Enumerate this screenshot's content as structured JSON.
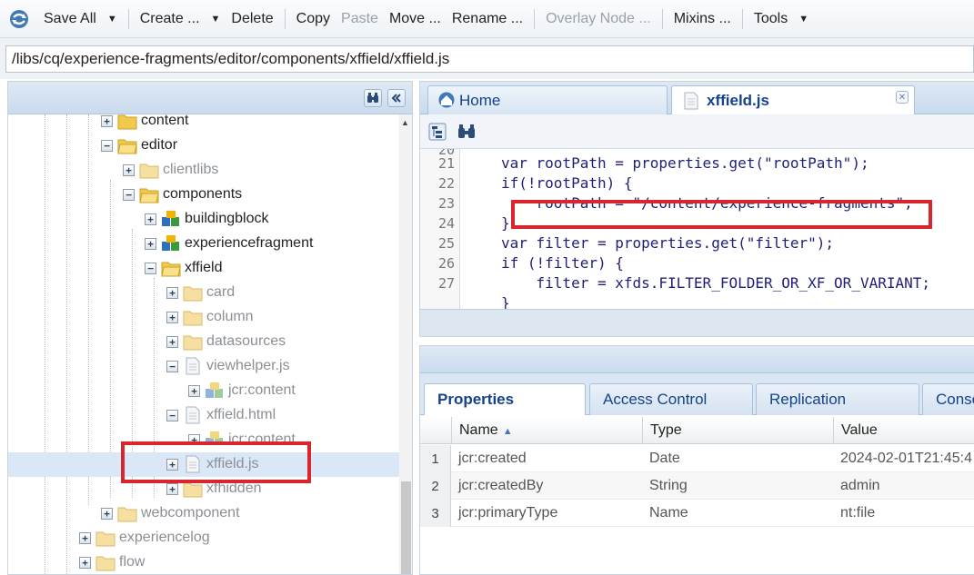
{
  "toolbar": {
    "save_all": "Save All",
    "create": "Create ...",
    "delete": "Delete",
    "copy": "Copy",
    "paste": "Paste",
    "move": "Move ...",
    "rename": "Rename ...",
    "overlay_node": "Overlay Node ...",
    "mixins": "Mixins ...",
    "tools": "Tools"
  },
  "path": {
    "value": "/libs/cq/experience-fragments/editor/components/xffield/xffield.js"
  },
  "tree": {
    "nodes": [
      {
        "label": "content",
        "icon": "folder-icon"
      },
      {
        "label": "editor",
        "icon": "folder-open-icon"
      },
      {
        "label": "clientlibs",
        "icon": "folder-icon"
      },
      {
        "label": "components",
        "icon": "folder-open-icon"
      },
      {
        "label": "buildingblock",
        "icon": "component-icon"
      },
      {
        "label": "experiencefragment",
        "icon": "component-icon"
      },
      {
        "label": "xffield",
        "icon": "folder-open-icon"
      },
      {
        "label": "card",
        "icon": "folder-icon"
      },
      {
        "label": "column",
        "icon": "folder-icon"
      },
      {
        "label": "datasources",
        "icon": "folder-icon"
      },
      {
        "label": "viewhelper.js",
        "icon": "file-icon"
      },
      {
        "label": "jcr:content",
        "icon": "node-icon"
      },
      {
        "label": "xffield.html",
        "icon": "file-icon"
      },
      {
        "label": "jcr:content",
        "icon": "node-icon"
      },
      {
        "label": "xffield.js",
        "icon": "file-icon"
      },
      {
        "label": "xfhidden",
        "icon": "folder-icon"
      },
      {
        "label": "webcomponent",
        "icon": "folder-icon"
      },
      {
        "label": "experiencelog",
        "icon": "folder-icon"
      },
      {
        "label": "flow",
        "icon": "folder-icon"
      }
    ]
  },
  "editor": {
    "tabs": [
      {
        "label": "Home"
      },
      {
        "label": "xffield.js"
      }
    ],
    "lines": [
      {
        "number": "20",
        "text": ""
      },
      {
        "number": "21",
        "text": "var rootPath = properties.get(\"rootPath\");"
      },
      {
        "number": "22",
        "text": "if(!rootPath) {"
      },
      {
        "number": "23",
        "text": "    rootPath = \"/content/experience-fragments\";"
      },
      {
        "number": "24",
        "text": "}"
      },
      {
        "number": "25",
        "text": "var filter = properties.get(\"filter\");"
      },
      {
        "number": "26",
        "text": "if (!filter) {"
      },
      {
        "number": "27",
        "text": "    filter = xfds.FILTER_FOLDER_OR_XF_OR_VARIANT;"
      },
      {
        "number": "",
        "text": "}"
      }
    ]
  },
  "properties": {
    "tabs": [
      "Properties",
      "Access Control",
      "Replication",
      "Conso"
    ],
    "columns": [
      "Name",
      "Type",
      "Value"
    ],
    "rows": [
      {
        "index": "1",
        "name": "jcr:created",
        "type": "Date",
        "value": "2024-02-01T21:45:4"
      },
      {
        "index": "2",
        "name": "jcr:createdBy",
        "type": "String",
        "value": "admin"
      },
      {
        "index": "3",
        "name": "jcr:primaryType",
        "type": "Name",
        "value": "nt:file"
      }
    ]
  },
  "colors": {
    "highlight": "#d9262e",
    "accent": "#15428b",
    "selection": "#dae7f6"
  }
}
